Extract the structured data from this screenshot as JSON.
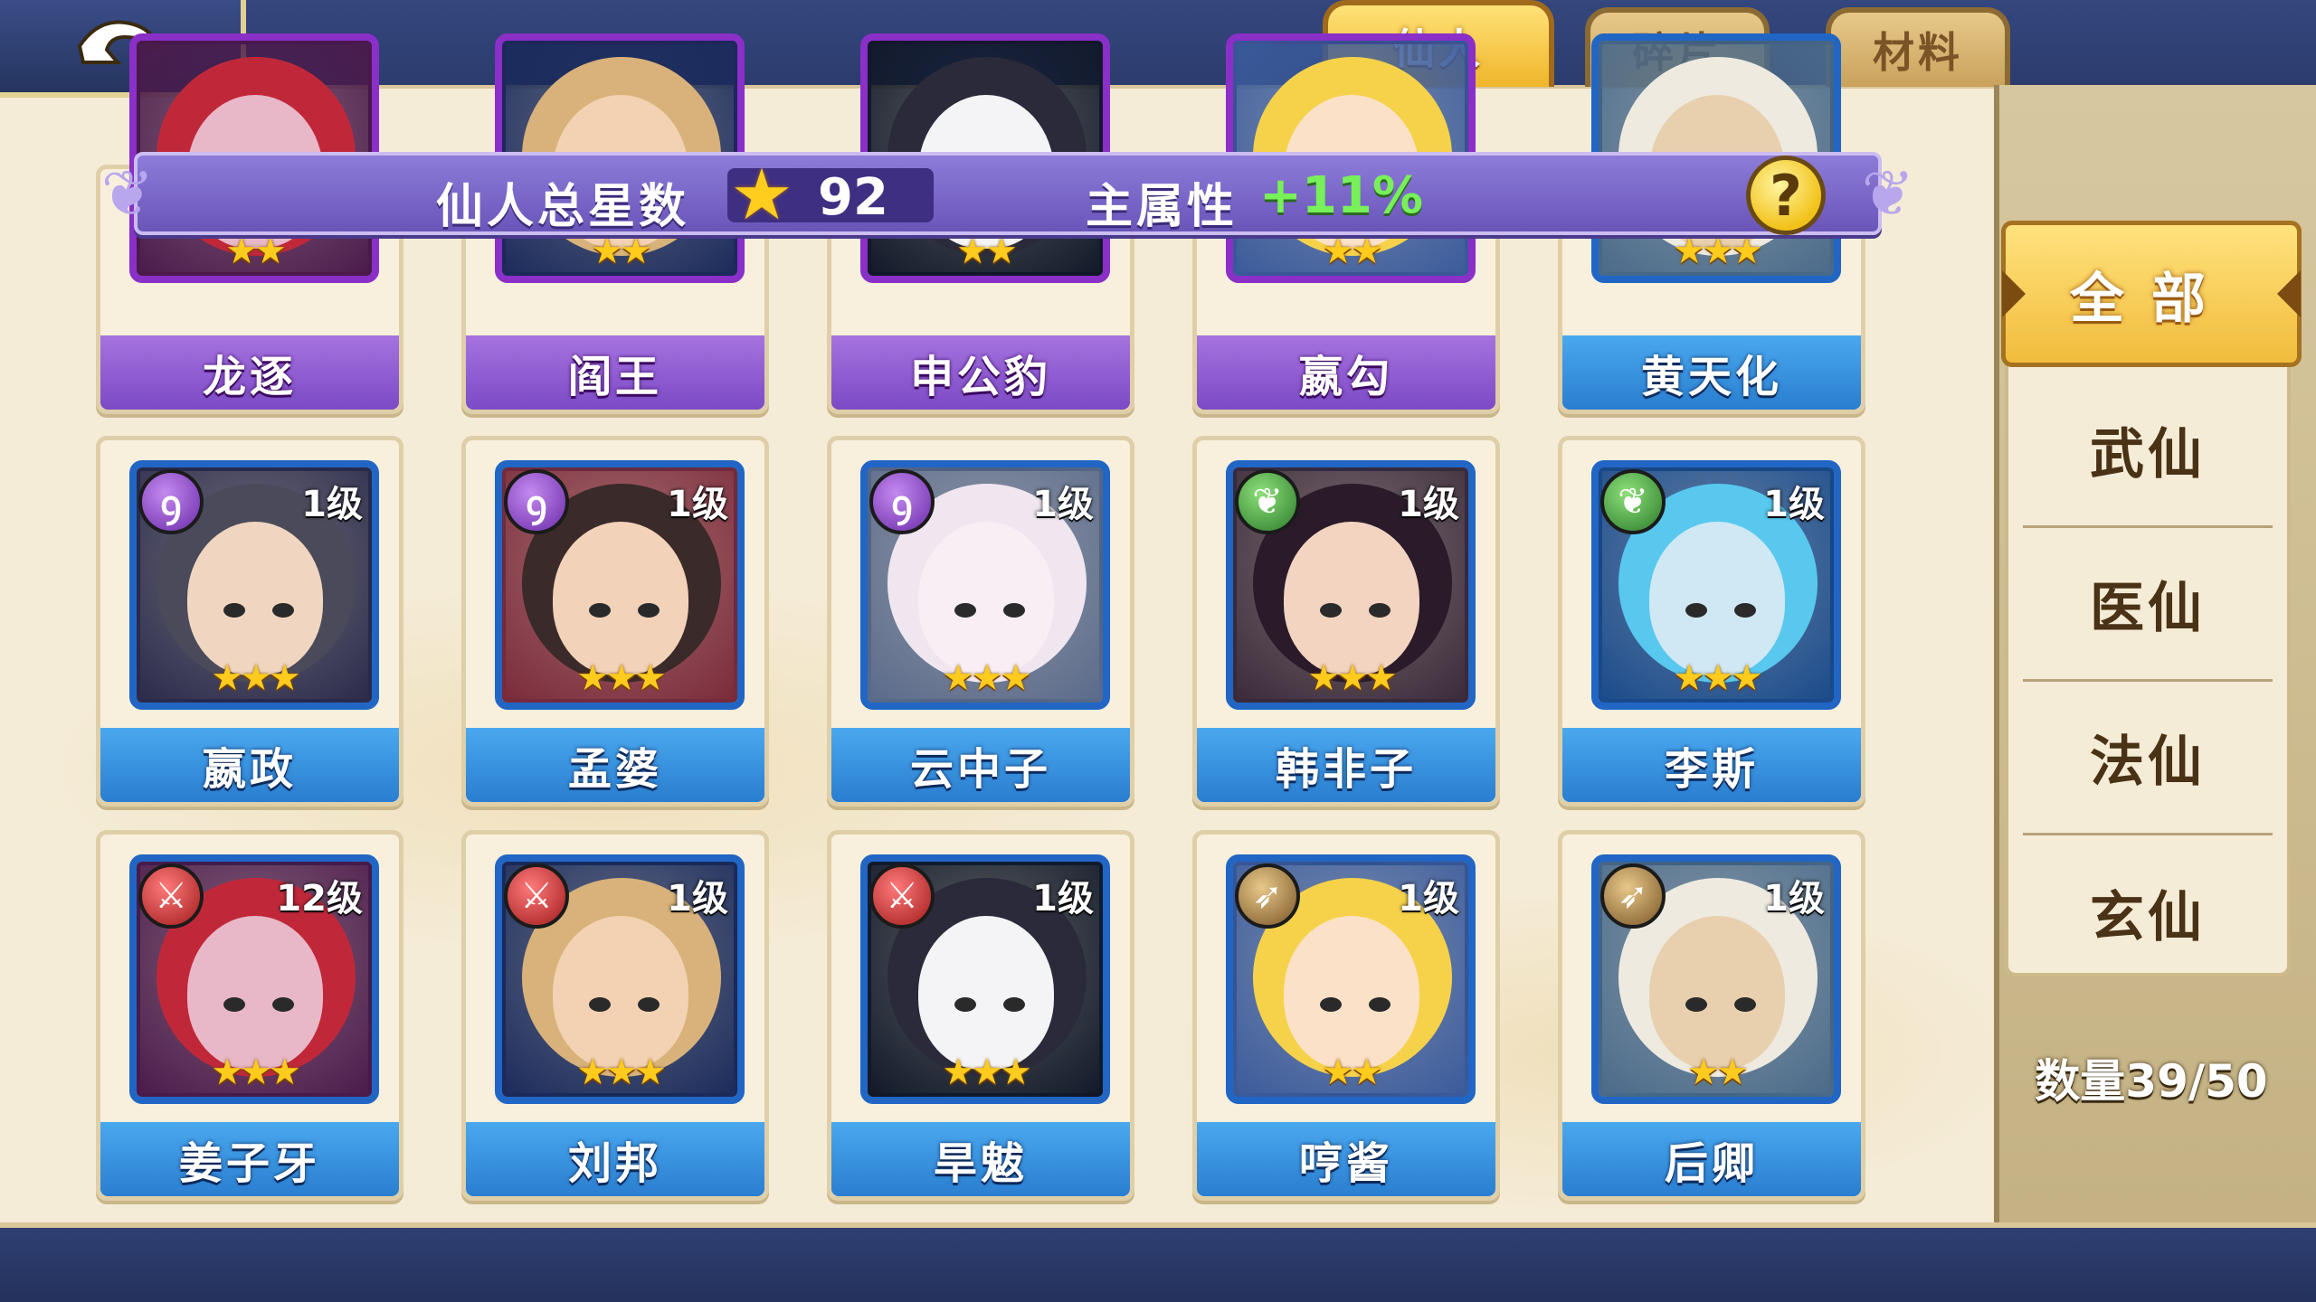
{
  "tabs": [
    {
      "label": "仙人",
      "active": true
    },
    {
      "label": "碎片",
      "active": false
    },
    {
      "label": "材料",
      "active": false
    }
  ],
  "info": {
    "total_stars_label": "仙人总星数",
    "total_stars": "92",
    "attr_label": "主属性",
    "attr_bonus": "+11%",
    "help_icon": "?"
  },
  "grid_rows": [
    [
      {
        "name": "龙逐",
        "stars": "★★",
        "rarity": "purple"
      },
      {
        "name": "阎王",
        "stars": "★★",
        "rarity": "purple"
      },
      {
        "name": "申公豹",
        "stars": "★★",
        "rarity": "purple"
      },
      {
        "name": "嬴勾",
        "stars": "★★",
        "rarity": "purple"
      },
      {
        "name": "黄天化",
        "stars": "★★★",
        "rarity": "blue"
      }
    ],
    [
      {
        "name": "嬴政",
        "level": "1级",
        "stars": "★★★",
        "element": "spiral"
      },
      {
        "name": "孟婆",
        "level": "1级",
        "stars": "★★★",
        "element": "spiral"
      },
      {
        "name": "云中子",
        "level": "1级",
        "stars": "★★★",
        "element": "spiral"
      },
      {
        "name": "韩非子",
        "level": "1级",
        "stars": "★★★",
        "element": "leaf"
      },
      {
        "name": "李斯",
        "level": "1级",
        "stars": "★★★",
        "element": "leaf"
      }
    ],
    [
      {
        "name": "姜子牙",
        "level": "12级",
        "stars": "★★★",
        "element": "sword"
      },
      {
        "name": "刘邦",
        "level": "1级",
        "stars": "★★★",
        "element": "sword"
      },
      {
        "name": "旱魃",
        "level": "1级",
        "stars": "★★★",
        "element": "sword"
      },
      {
        "name": "哼酱",
        "level": "1级",
        "stars": "★★",
        "element": "bow"
      },
      {
        "name": "后卿",
        "level": "1级",
        "stars": "★★",
        "element": "bow"
      }
    ]
  ],
  "filters": [
    {
      "label": "全部",
      "active": true
    },
    {
      "label": "武仙",
      "active": false
    },
    {
      "label": "医仙",
      "active": false
    },
    {
      "label": "法仙",
      "active": false
    },
    {
      "label": "玄仙",
      "active": false
    }
  ],
  "count_text": "数量39/50",
  "colors": {
    "gold": "#f0b52b",
    "blue_rarity": "#2166c4",
    "purple_rarity": "#8a2fc8",
    "bonus_green": "#78f05a"
  }
}
